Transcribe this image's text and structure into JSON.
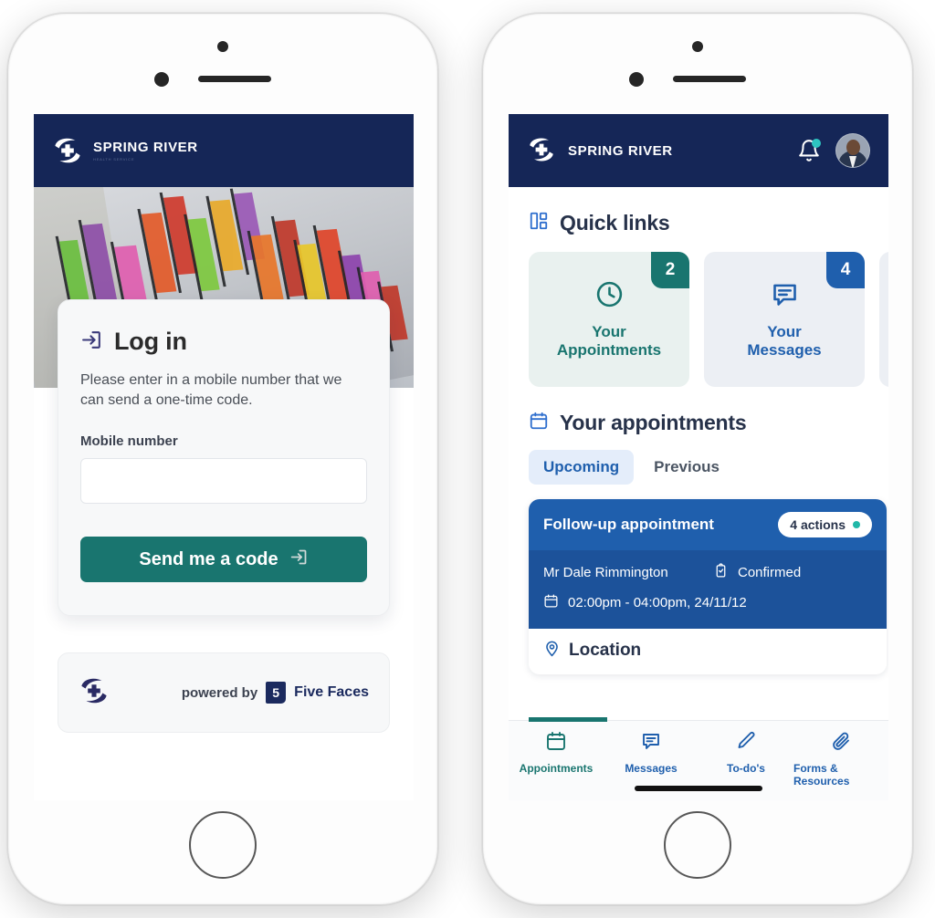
{
  "brand": {
    "name": "SPRING RIVER",
    "subtitle": "HEALTH SERVICE",
    "logo_icon": "spring-river-logo-icon",
    "header_bg": "#152657"
  },
  "colors": {
    "navy": "#152657",
    "teal": "#19756f",
    "blue": "#1f5fad",
    "card_blue": "#1c529a",
    "accent_dot": "#2ec4c0"
  },
  "login_screen": {
    "card": {
      "icon": "login-arrow-icon",
      "title": "Log in",
      "description": "Please enter in a mobile number that we can send a one-time code.",
      "field_label": "Mobile number",
      "field_value": "",
      "field_placeholder": "",
      "submit_label": "Send me a code",
      "submit_icon": "login-arrow-icon"
    },
    "footer": {
      "logo_icon": "spring-river-logo-icon",
      "powered_by_label": "powered by",
      "badge_text": "5",
      "vendor_name": "Five Faces"
    }
  },
  "dashboard_screen": {
    "header": {
      "bell_icon": "bell-icon",
      "has_notification": true,
      "avatar_icon": "avatar"
    },
    "quick_links": {
      "icon": "dashboard-grid-icon",
      "title": "Quick links",
      "cards": [
        {
          "label_line1": "Your",
          "label_line2": "Appointments",
          "badge": "2",
          "theme": "teal",
          "icon": "clock-icon"
        },
        {
          "label_line1": "Your",
          "label_line2": "Messages",
          "badge": "4",
          "theme": "blue",
          "icon": "message-icon"
        },
        {
          "label_line1": "",
          "label_line2": "",
          "badge": "",
          "theme": "plain",
          "icon": ""
        }
      ]
    },
    "appointments": {
      "icon": "calendar-icon",
      "title": "Your appointments",
      "tabs": [
        {
          "label": "Upcoming",
          "active": true
        },
        {
          "label": "Previous",
          "active": false
        }
      ],
      "cards": [
        {
          "title": "Follow-up appointment",
          "actions_label": "4 actions",
          "person": "Mr Dale Rimmington",
          "status": "Confirmed",
          "status_icon": "clipboard-icon",
          "datetime": "02:00pm - 04:00pm, 24/11/12",
          "datetime_icon": "calendar-icon",
          "location_label": "Location",
          "location_icon": "map-pin-icon"
        }
      ]
    },
    "bottom_nav": [
      {
        "label": "Appointments",
        "icon": "calendar-icon",
        "active": true
      },
      {
        "label": "Messages",
        "icon": "message-icon",
        "active": false
      },
      {
        "label": "To-do's",
        "icon": "pencil-icon",
        "active": false
      },
      {
        "label": "Forms & Resources",
        "icon": "paperclip-icon",
        "active": false
      }
    ]
  }
}
